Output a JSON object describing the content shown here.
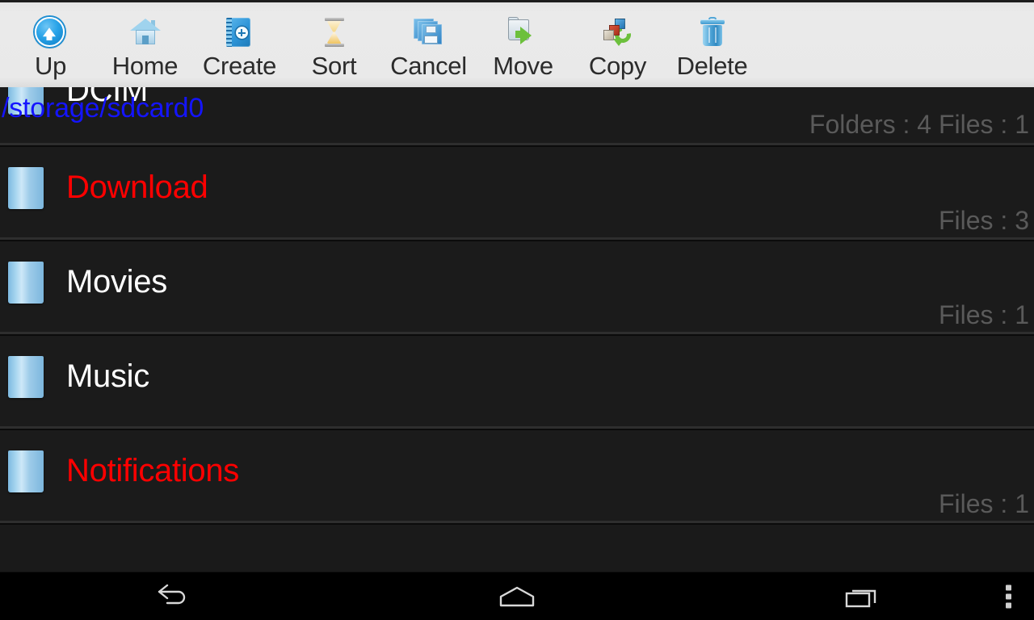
{
  "toolbar": {
    "buttons": [
      {
        "label": "Up",
        "icon": "up-arrow-circle-icon"
      },
      {
        "label": "Home",
        "icon": "home-icon"
      },
      {
        "label": "Create",
        "icon": "new-notebook-icon"
      },
      {
        "label": "Sort",
        "icon": "hourglass-icon"
      },
      {
        "label": "Cancel",
        "icon": "floppy-disks-icon"
      },
      {
        "label": "Move",
        "icon": "folder-arrow-icon"
      },
      {
        "label": "Copy",
        "icon": "copy-refresh-icon"
      },
      {
        "label": "Delete",
        "icon": "trash-can-icon"
      }
    ]
  },
  "path": {
    "current": "/storage/sdcard0"
  },
  "colors": {
    "toolbar_bg": "#e9e9e9",
    "toolbar_text": "#2b2b2b",
    "list_bg": "#1b1b1b",
    "path_text": "#1414ff",
    "item_normal": "#ffffff",
    "item_highlight": "#ff0000",
    "count_text": "#5a5a5a"
  },
  "list": {
    "items": [
      {
        "name": "DCIM",
        "count": "Folders : 4 Files : 1",
        "highlight": false,
        "clipped": true
      },
      {
        "name": "Download",
        "count": "Files : 3",
        "highlight": true,
        "clipped": false
      },
      {
        "name": "Movies",
        "count": "Files : 1",
        "highlight": false,
        "clipped": false
      },
      {
        "name": "Music",
        "count": "",
        "highlight": false,
        "clipped": false
      },
      {
        "name": "Notifications",
        "count": "Files : 1",
        "highlight": true,
        "clipped": false
      }
    ]
  },
  "navbar": {
    "back_icon": "back-arrow-icon",
    "home_icon": "home-pentagon-icon",
    "recents_icon": "recent-apps-icon",
    "overflow_icon": "overflow-menu-icon"
  }
}
